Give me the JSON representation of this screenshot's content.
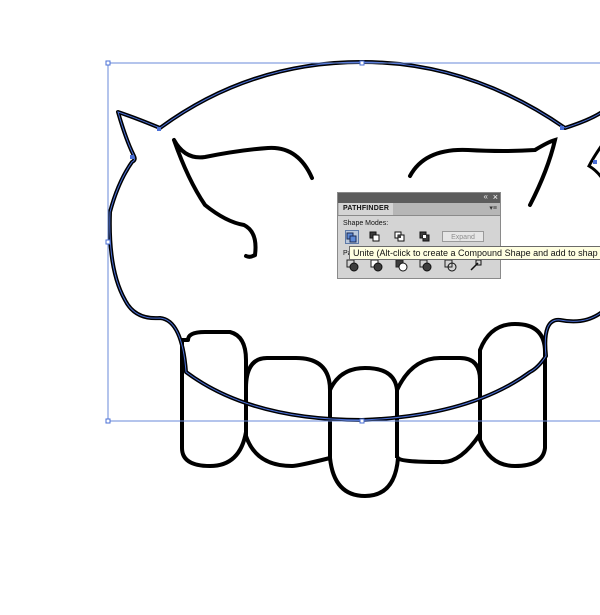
{
  "panel": {
    "title": "PATHFINDER",
    "collapse_icon": "«",
    "close_icon": "×",
    "menu_icon": "▾≡",
    "shape_modes_label": "Shape Modes:",
    "pathfinders_label": "Pa",
    "expand_label": "Expand"
  },
  "tooltip": {
    "text": "Unite (Alt-click to create a Compound Shape and add to shap"
  },
  "colors": {
    "selection": "#4a6fd6",
    "stroke": "#000000",
    "panel_bg": "#d4d4d4"
  }
}
